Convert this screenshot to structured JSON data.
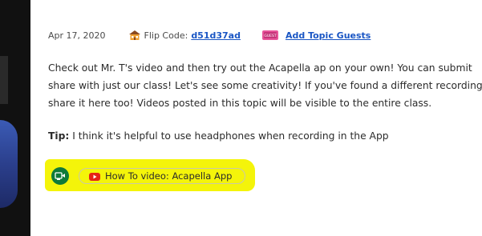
{
  "post": {
    "date": "Apr 17, 2020",
    "flip_code_label": "Flip Code:",
    "flip_code": "d51d37ad",
    "add_guests_label": "Add Topic Guests",
    "guest_badge_text": "GUEST",
    "description_lines": [
      "Check out Mr. T's video and then try out the Acapella ap on your own!   You can submit",
      "share with just our class!  Let's see some creativity!  If you've found a different recording",
      "share it here too!  Videos posted in this topic will be visible to the entire class."
    ],
    "tip_label": "Tip:",
    "tip_text": " I think it's helpful to use headphones when recording in the App",
    "video_link_label": "How To video: Acapella App"
  },
  "colors": {
    "link": "#1a56c4",
    "highlight": "#f4f40a",
    "badge_green": "#0f7a3a",
    "youtube_red": "#e62117"
  }
}
